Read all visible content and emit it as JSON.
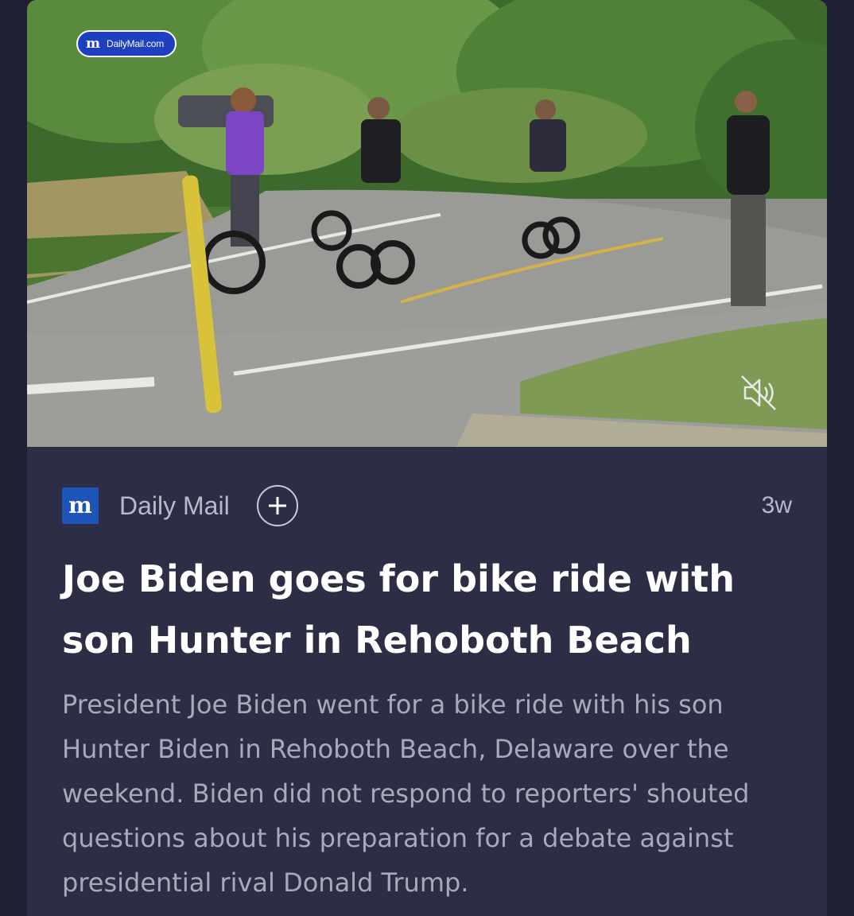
{
  "video": {
    "watermark_logo": "m",
    "watermark_text": "DailyMail.com",
    "mute_icon": "speaker-muted-icon"
  },
  "article": {
    "publisher_logo": "m",
    "publisher": "Daily Mail",
    "follow_icon": "plus-icon",
    "age": "3w",
    "headline": "Joe Biden goes for bike ride with son Hunter in Rehoboth Beach",
    "summary": "President Joe Biden went for a bike ride with his son Hunter Biden in Rehoboth Beach, Delaware over the weekend. Biden did not respond to reporters' shouted questions about his preparation for a debate against presidential rival Donald Trump."
  },
  "colors": {
    "background": "#202034",
    "card": "#2d2d45",
    "publisher_brand": "#1c54b7",
    "headline": "#ffffff",
    "summary": "#a9a9b9"
  }
}
